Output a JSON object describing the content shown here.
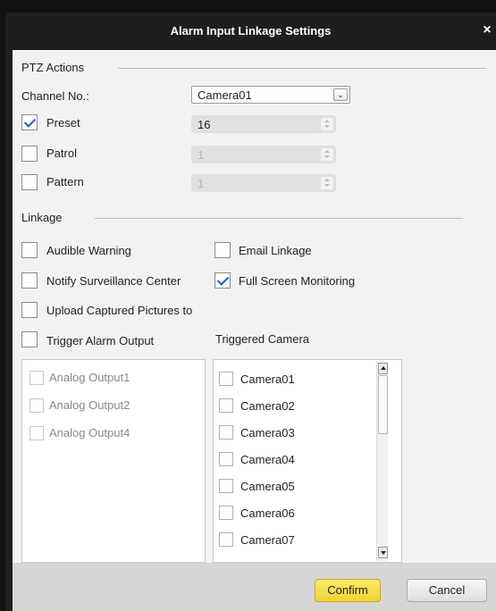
{
  "dialog": {
    "title": "Alarm Input Linkage Settings",
    "close_glyph": "×"
  },
  "ptz": {
    "section_label": "PTZ Actions",
    "channel_label": "Channel No.:",
    "channel_value": "Camera01",
    "preset": {
      "label": "Preset",
      "checked": true,
      "value": "16"
    },
    "patrol": {
      "label": "Patrol",
      "checked": false,
      "value": "1"
    },
    "pattern": {
      "label": "Pattern",
      "checked": false,
      "value": "1"
    }
  },
  "linkage": {
    "section_label": "Linkage",
    "audible_warning": {
      "label": "Audible Warning",
      "checked": false
    },
    "email_linkage": {
      "label": "Email Linkage",
      "checked": false
    },
    "notify_center": {
      "label": "Notify Surveillance Center",
      "checked": false
    },
    "full_screen": {
      "label": "Full Screen Monitoring",
      "checked": true
    },
    "upload_pictures": {
      "label": "Upload Captured Pictures to",
      "checked": false
    },
    "trigger_output": {
      "label": "Trigger Alarm Output",
      "checked": false
    },
    "triggered_camera_label": "Triggered Camera",
    "alarm_outputs": [
      "Analog Output1",
      "Analog Output2",
      "Analog Output4"
    ],
    "cameras": [
      "Camera01",
      "Camera02",
      "Camera03",
      "Camera04",
      "Camera05",
      "Camera06",
      "Camera07"
    ]
  },
  "footer": {
    "confirm_label": "Confirm",
    "cancel_label": "Cancel"
  },
  "colors": {
    "accent_confirm": "#f1d335",
    "check": "#1a63c9",
    "titlebar": "#1e1e1e"
  }
}
